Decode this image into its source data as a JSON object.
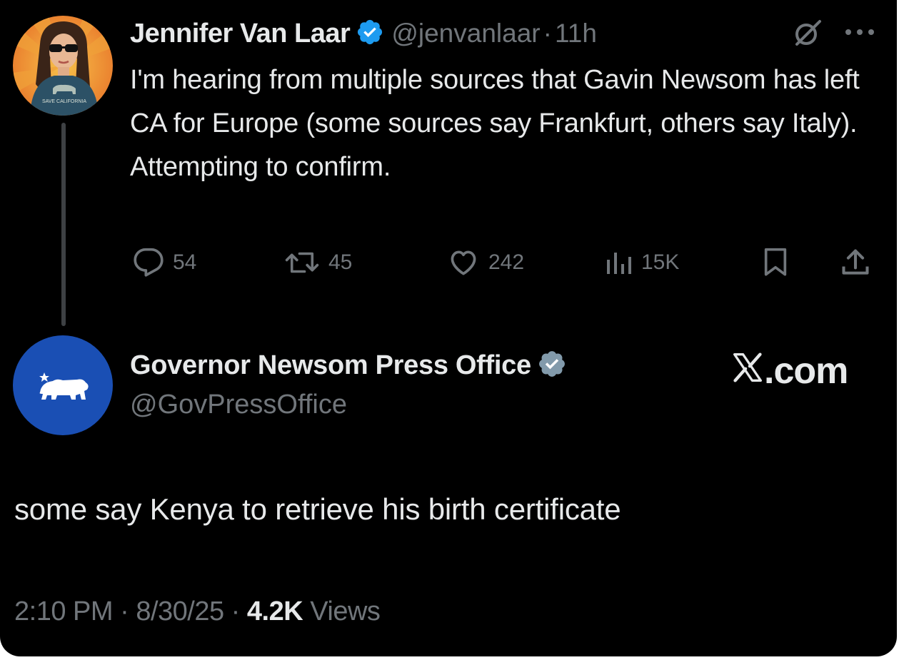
{
  "tweet1": {
    "author_name": "Jennifer Van Laar",
    "handle": "@jenvanlaar",
    "separator": "·",
    "time": "11h",
    "text": "I'm hearing from multiple sources that Gavin Newsom has left CA for Europe (some sources say Frankfurt, others say Italy). Attempting to confirm.",
    "avatar_shirt_text": "SAVE CALIFORNIA",
    "verified_color": "#1d9bf0",
    "actions": {
      "replies": "54",
      "reposts": "45",
      "likes": "242",
      "views": "15K"
    }
  },
  "tweet2": {
    "author_name": "Governor Newsom Press Office",
    "handle": "@GovPressOffice",
    "verified_color": "#829aab",
    "watermark": ".com",
    "text": "some say Kenya to retrieve his birth certificate",
    "timestamp_time": "2:10 PM",
    "timestamp_sep": " · ",
    "timestamp_date": "8/30/25",
    "views_sep": " · ",
    "views_count": "4.2K",
    "views_label": " Views"
  },
  "icons": [
    "verified-badge-icon",
    "grok-icon",
    "more-icon",
    "reply-icon",
    "repost-icon",
    "like-icon",
    "views-icon",
    "bookmark-icon",
    "share-icon",
    "x-logo-icon",
    "california-bear-icon"
  ],
  "colors": {
    "background": "#000000",
    "text_primary": "#e7e9ea",
    "text_secondary": "#71767b",
    "thread_line": "#3e4144",
    "avatar2_bg": "#1a4fb4"
  }
}
